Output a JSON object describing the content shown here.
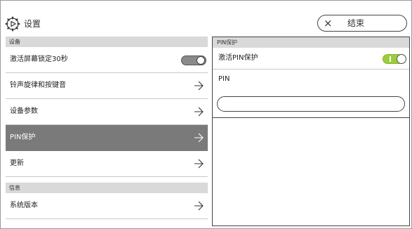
{
  "header": {
    "title": "设置",
    "icon": "gear-icon",
    "end_button": {
      "icon": "close-icon",
      "label": "结束"
    }
  },
  "left": {
    "sections": [
      {
        "header": "设备",
        "items": [
          {
            "label": "激活屏幕锁定30秒",
            "control": "toggle",
            "toggle_on": false
          },
          {
            "label": "铃声旋律和按键音",
            "control": "arrow"
          },
          {
            "label": "设备参数",
            "control": "arrow"
          },
          {
            "label": "PIN保护",
            "control": "arrow",
            "selected": true
          },
          {
            "label": "更新",
            "control": "arrow"
          }
        ]
      },
      {
        "header": "信息",
        "items": [
          {
            "label": "系统版本",
            "control": "arrow"
          }
        ]
      }
    ]
  },
  "right": {
    "header": "PIN保护",
    "activate_label": "激活PIN保护",
    "activate_on": true,
    "pin_label": "PIN",
    "pin_value": "",
    "pin_placeholder": ""
  },
  "colors": {
    "toggle_on": "#9bcc3c",
    "selected_row": "#7a7a7a",
    "section_header": "#d9d9d9"
  }
}
